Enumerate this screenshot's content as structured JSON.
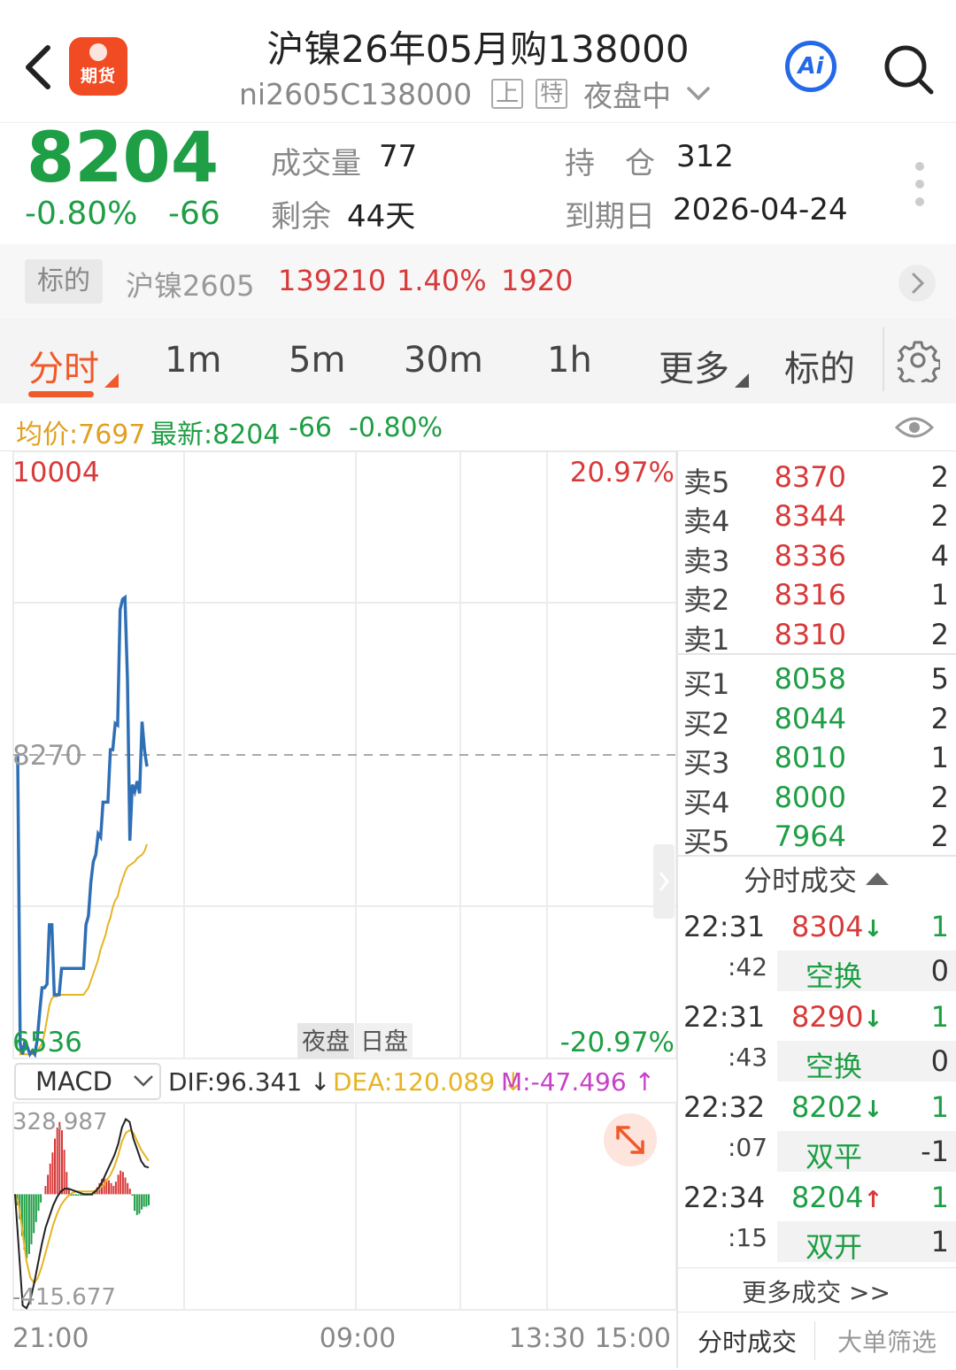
{
  "header": {
    "title": "沪镍26年05月购138000",
    "code": "ni2605C138000",
    "tags": [
      "上",
      "特"
    ],
    "session": "夜盘中",
    "logo_text": "期货",
    "ai_label": "Ai"
  },
  "quote": {
    "price": "8204",
    "pct": "-0.80%",
    "change": "-66",
    "volume_label": "成交量",
    "volume": "77",
    "remain_label": "剩余",
    "remain": "44天",
    "oi_label": "持　仓",
    "oi": "312",
    "expiry_label": "到期日",
    "expiry": "2026-04-24"
  },
  "underlying": {
    "tag": "标的",
    "name": "沪镍2605",
    "price": "139210",
    "pct": "1.40%",
    "change": "1920"
  },
  "tabs": [
    {
      "label": "分时",
      "active": true
    },
    {
      "label": "1m"
    },
    {
      "label": "5m"
    },
    {
      "label": "30m"
    },
    {
      "label": "1h"
    },
    {
      "label": "更多"
    },
    {
      "label": "标的"
    }
  ],
  "avg_line": {
    "avg": "均价:7697",
    "latest": "最新:8204",
    "chg": "-66",
    "pct": "-0.80%"
  },
  "colors": {
    "up": "#d83a3a",
    "down": "#1e9e45",
    "accent": "#f0592a",
    "price_line": "#2e6fb5",
    "avg_line": "#e6b422",
    "macd_m": "#c840c8"
  },
  "chart_data": [
    {
      "type": "line",
      "name": "intraday",
      "ylim": [
        6536,
        10004
      ],
      "ref_price": 8270,
      "labels": {
        "y_top": "10004",
        "y_bottom": "6536",
        "ref": "8270",
        "pct_top": "20.97%",
        "pct_bottom": "-20.97%",
        "session_night": "夜盘",
        "session_day": "日盘"
      },
      "x_ticks": [
        "21:00",
        "09:00",
        "13:30",
        "15:00"
      ],
      "series": [
        {
          "values": [
            8270,
            6620,
            6560,
            6640,
            6600,
            6560,
            6580,
            6560,
            6640,
            6800,
            6940,
            6940,
            6960,
            7300,
            7300,
            6900,
            6900,
            6900,
            7050,
            7050,
            7050,
            7050,
            7050,
            7050,
            7050,
            7050,
            7050,
            7050,
            7300,
            7350,
            7540,
            7660,
            7700,
            7820,
            7800,
            8000,
            8000,
            8000,
            8300,
            8300,
            8450,
            8440,
            9100,
            9160,
            9170,
            8700,
            7780,
            8100,
            8060,
            8120,
            8050,
            8460,
            8300,
            8204
          ]
        },
        {
          "values": [
            8270,
            6560,
            6560,
            6560,
            6560,
            6560,
            6560,
            6560,
            6580,
            6600,
            6620,
            6680,
            6760,
            6840,
            6880,
            6890,
            6890,
            6900,
            6900,
            6900,
            6900,
            6900,
            6900,
            6900,
            6900,
            6900,
            6900,
            6900,
            6920,
            6940,
            6980,
            7020,
            7060,
            7100,
            7160,
            7200,
            7240,
            7300,
            7340,
            7400,
            7440,
            7460,
            7520,
            7560,
            7600,
            7630,
            7640,
            7650,
            7660,
            7680,
            7690,
            7700,
            7720,
            7760
          ]
        }
      ]
    },
    {
      "type": "bar",
      "name": "MACD",
      "indicator": "MACD",
      "dif": "DIF:96.341",
      "dea": "DEA:120.089",
      "m": "M:-47.496",
      "ylim": [
        -415.677,
        328.987
      ],
      "labels": {
        "y_top": "328.987",
        "y_bottom": "-415.677"
      },
      "series": [
        {
          "name": "M",
          "values": [
            -5,
            -40,
            -90,
            -150,
            -200,
            -230,
            -215,
            -180,
            -140,
            -100,
            -60,
            -30,
            0,
            30,
            70,
            110,
            150,
            200,
            240,
            260,
            230,
            160,
            80,
            20,
            -5,
            -5,
            -5,
            -5,
            -5,
            -5,
            -5,
            -5,
            -5,
            -5,
            10,
            25,
            40,
            55,
            60,
            55,
            50,
            40,
            30,
            45,
            70,
            85,
            80,
            60,
            40,
            20,
            -5,
            -60,
            -75,
            -70,
            -55,
            -45,
            -45,
            -40
          ]
        },
        {
          "name": "DIF",
          "values": [
            0,
            -200,
            -400,
            -410,
            -380,
            -320,
            -250,
            -180,
            -120,
            -80,
            -40,
            -10,
            10,
            20,
            20,
            15,
            10,
            5,
            0,
            0,
            0,
            10,
            25,
            50,
            80,
            110,
            140,
            180,
            240,
            270,
            260,
            200,
            160,
            120,
            100,
            96
          ]
        },
        {
          "name": "DEA",
          "values": [
            0,
            -40,
            -140,
            -240,
            -300,
            -320,
            -300,
            -260,
            -210,
            -160,
            -110,
            -70,
            -40,
            -20,
            -5,
            5,
            10,
            10,
            10,
            10,
            10,
            12,
            20,
            30,
            50,
            70,
            100,
            140,
            190,
            220,
            230,
            220,
            190,
            160,
            140,
            120
          ]
        }
      ]
    }
  ],
  "order_book": {
    "asks": [
      {
        "label": "卖5",
        "price": "8370",
        "vol": "2"
      },
      {
        "label": "卖4",
        "price": "8344",
        "vol": "2"
      },
      {
        "label": "卖3",
        "price": "8336",
        "vol": "4"
      },
      {
        "label": "卖2",
        "price": "8316",
        "vol": "1"
      },
      {
        "label": "卖1",
        "price": "8310",
        "vol": "2"
      }
    ],
    "bids": [
      {
        "label": "买1",
        "price": "8058",
        "vol": "5"
      },
      {
        "label": "买2",
        "price": "8044",
        "vol": "2"
      },
      {
        "label": "买3",
        "price": "8010",
        "vol": "1"
      },
      {
        "label": "买4",
        "price": "8000",
        "vol": "2"
      },
      {
        "label": "买5",
        "price": "7964",
        "vol": "2"
      }
    ]
  },
  "trades": {
    "title": "分时成交",
    "items": [
      {
        "time": "22:31",
        "sec": ":42",
        "price": "8304",
        "dir": "↓",
        "vol": "1",
        "type": "空换",
        "oi": "0",
        "color": "red"
      },
      {
        "time": "22:31",
        "sec": ":43",
        "price": "8290",
        "dir": "↓",
        "vol": "1",
        "type": "空换",
        "oi": "0",
        "color": "red"
      },
      {
        "time": "22:32",
        "sec": ":07",
        "price": "8202",
        "dir": "↓",
        "vol": "1",
        "type": "双平",
        "oi": "-1",
        "color": "green"
      },
      {
        "time": "22:34",
        "sec": ":15",
        "price": "8204",
        "dir": "↑",
        "vol": "1",
        "type": "双开",
        "oi": "1",
        "color": "green"
      }
    ],
    "more": "更多成交 >>",
    "bottom_tabs": [
      "分时成交",
      "大单筛选"
    ]
  }
}
